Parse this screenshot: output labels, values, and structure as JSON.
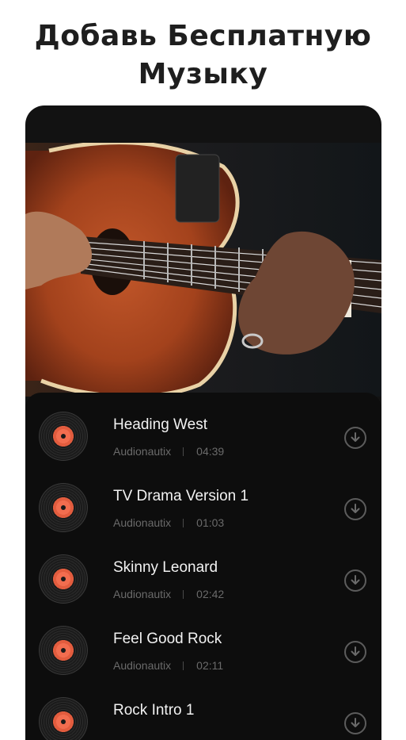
{
  "headline": {
    "line1": "Добавь Бесплатную",
    "line2": "Музыку"
  },
  "tracks": [
    {
      "title": "Heading West",
      "artist": "Audionautix",
      "duration": "04:39"
    },
    {
      "title": "TV Drama Version 1",
      "artist": "Audionautix",
      "duration": "01:03"
    },
    {
      "title": "Skinny Leonard",
      "artist": "Audionautix",
      "duration": "02:42"
    },
    {
      "title": "Feel Good Rock",
      "artist": "Audionautix",
      "duration": "02:11"
    },
    {
      "title": "Rock Intro 1",
      "artist": "",
      "duration": ""
    }
  ],
  "icons": {
    "track_art": "vinyl-record-icon",
    "download": "download-icon"
  },
  "colors": {
    "background": "#ffffff",
    "headline": "#1e1e1e",
    "panel": "#121212",
    "vinyl_label": "#f26d4f"
  }
}
